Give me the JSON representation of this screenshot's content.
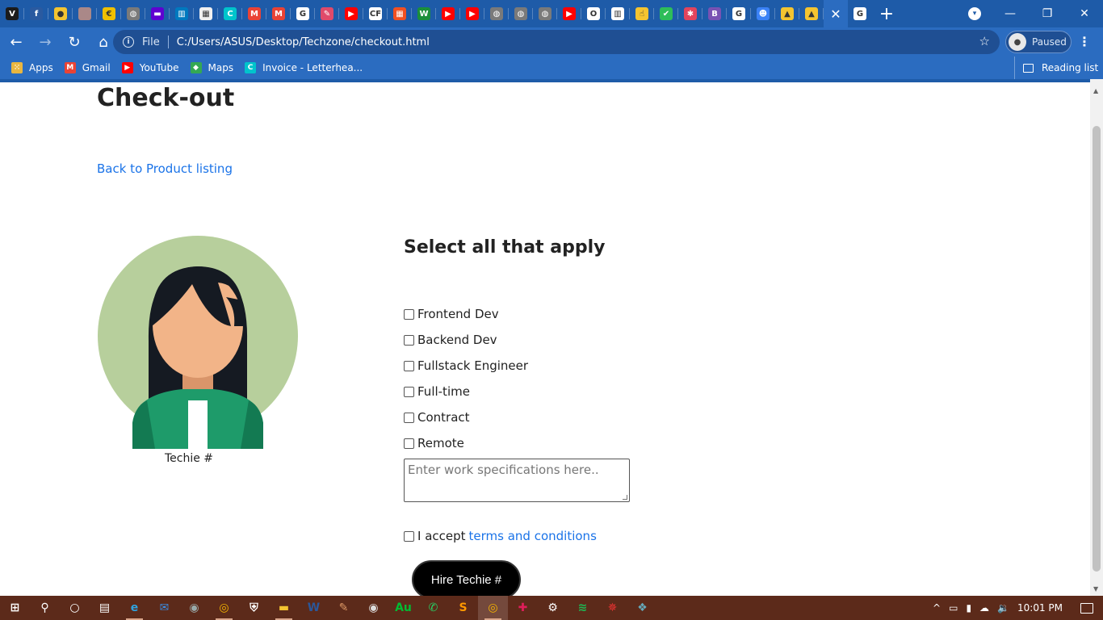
{
  "browser": {
    "tab_favicons": [
      {
        "name": "vuetify-icon",
        "color": "#1b1b1b",
        "glyph": "V"
      },
      {
        "name": "feather-icon",
        "color": "#2a5aa0",
        "glyph": "f"
      },
      {
        "name": "circle-yellow-icon",
        "color": "#f4c430",
        "glyph": "●"
      },
      {
        "name": "profile-photo-icon",
        "color": "#a88",
        "glyph": ""
      },
      {
        "name": "coinbase-icon",
        "color": "#f0c000",
        "glyph": "€"
      },
      {
        "name": "globe-icon",
        "color": "#7a7a7a",
        "glyph": "◍"
      },
      {
        "name": "yahoo-icon",
        "color": "#5f01d1",
        "glyph": "▬"
      },
      {
        "name": "trello-icon",
        "color": "#0079bf",
        "glyph": "▥"
      },
      {
        "name": "jsfiddle-icon",
        "color": "#f0f0f0",
        "glyph": "▦"
      },
      {
        "name": "canva-icon",
        "color": "#00c4cc",
        "glyph": "C"
      },
      {
        "name": "gmail-icon",
        "color": "#ea4335",
        "glyph": "M"
      },
      {
        "name": "gmail-icon-2",
        "color": "#ea4335",
        "glyph": "M"
      },
      {
        "name": "google-icon",
        "color": "#ffffff",
        "glyph": "G"
      },
      {
        "name": "quill-icon",
        "color": "#e04a6a",
        "glyph": "✎"
      },
      {
        "name": "youtube-icon",
        "color": "#ff0000",
        "glyph": "▶"
      },
      {
        "name": "codeforces-icon",
        "color": "#ffffff",
        "glyph": "CF"
      },
      {
        "name": "microsoft-icon",
        "color": "#f25022",
        "glyph": "▦"
      },
      {
        "name": "w-icon",
        "color": "#1a8f3a",
        "glyph": "W"
      },
      {
        "name": "youtube-icon-2",
        "color": "#ff0000",
        "glyph": "▶"
      },
      {
        "name": "youtube-icon-3",
        "color": "#ff0000",
        "glyph": "▶"
      },
      {
        "name": "globe-icon-2",
        "color": "#7a7a7a",
        "glyph": "◍"
      },
      {
        "name": "globe-icon-3",
        "color": "#7a7a7a",
        "glyph": "◍"
      },
      {
        "name": "globe-icon-4",
        "color": "#7a7a7a",
        "glyph": "◍"
      },
      {
        "name": "youtube-icon-4",
        "color": "#ff0000",
        "glyph": "▶"
      },
      {
        "name": "outlook-icon",
        "color": "#ffffff",
        "glyph": "O"
      },
      {
        "name": "trello-icon-2",
        "color": "#ffffff",
        "glyph": "▥"
      },
      {
        "name": "finger-icon",
        "color": "#f4c430",
        "glyph": "☝"
      },
      {
        "name": "check-icon",
        "color": "#2ebd59",
        "glyph": "✔"
      },
      {
        "name": "asterisk-icon",
        "color": "#e2445c",
        "glyph": "✱"
      },
      {
        "name": "bootstrap-icon",
        "color": "#7952b3",
        "glyph": "B"
      },
      {
        "name": "google-icon-2",
        "color": "#ffffff",
        "glyph": "G"
      },
      {
        "name": "puzzle-icon",
        "color": "#3b82f6",
        "glyph": "☻"
      },
      {
        "name": "image-icon",
        "color": "#f4c430",
        "glyph": "▲"
      },
      {
        "name": "image-icon-2",
        "color": "#f4c430",
        "glyph": "▲"
      }
    ],
    "active_tab_close": "✕",
    "after_active_favicon": {
      "name": "google-icon-3",
      "color": "#ffffff",
      "glyph": "G"
    },
    "new_tab": "+",
    "window_controls": {
      "minimize": "—",
      "restore": "❐",
      "close": "✕"
    },
    "tab_search": "▾",
    "nav": {
      "back": "←",
      "forward": "→",
      "reload": "↻",
      "home": "⌂"
    },
    "omnibox": {
      "info": "i",
      "scheme_label": "File",
      "url": "C:/Users/ASUS/Desktop/Techzone/checkout.html",
      "star": "☆"
    },
    "profile": {
      "label": "Paused"
    },
    "menu": "⋮",
    "bookmarks": [
      {
        "label": "Apps",
        "icon": "apps-grid-icon",
        "color": "#e9b640",
        "glyph": "⁙"
      },
      {
        "label": "Gmail",
        "icon": "gmail-icon",
        "color": "#ea4335",
        "glyph": "M"
      },
      {
        "label": "YouTube",
        "icon": "youtube-icon",
        "color": "#ff0000",
        "glyph": "▶"
      },
      {
        "label": "Maps",
        "icon": "maps-icon",
        "color": "#34a853",
        "glyph": "◆"
      },
      {
        "label": "Invoice - Letterhea...",
        "icon": "canva-icon",
        "color": "#00c4cc",
        "glyph": "C"
      }
    ],
    "reading_list": "Reading list"
  },
  "page": {
    "title": "Check-out",
    "back_link": "Back to Product listing",
    "avatar_caption": "Techie #",
    "form_heading": "Select all that apply",
    "options": [
      "Frontend Dev",
      "Backend Dev",
      "Fullstack Engineer",
      "Full-time",
      "Contract",
      "Remote"
    ],
    "textarea_placeholder": "Enter work specifications here..",
    "terms_prefix": "I accept",
    "terms_link": "terms and conditions",
    "submit": "Hire Techie #"
  },
  "taskbar": {
    "apps": [
      {
        "name": "start-icon",
        "color": "#ffffff",
        "glyph": "⊞"
      },
      {
        "name": "search-icon",
        "color": "#ffffff",
        "glyph": "⚲"
      },
      {
        "name": "cortana-icon",
        "color": "#ffffff",
        "glyph": "○"
      },
      {
        "name": "task-view-icon",
        "color": "#ffffff",
        "glyph": "▤"
      },
      {
        "name": "edge-icon",
        "color": "#2fa3e0",
        "glyph": "e"
      },
      {
        "name": "mail-icon",
        "color": "#3a8ee6",
        "glyph": "✉"
      },
      {
        "name": "camera-icon",
        "color": "#9aa",
        "glyph": "◉"
      },
      {
        "name": "chrome-icon",
        "color": "#f4b400",
        "glyph": "◎"
      },
      {
        "name": "security-icon",
        "color": "#ffffff",
        "glyph": "⛨"
      },
      {
        "name": "file-explorer-icon",
        "color": "#f4c430",
        "glyph": "▬"
      },
      {
        "name": "word-icon",
        "color": "#2b579a",
        "glyph": "W"
      },
      {
        "name": "paint-icon",
        "color": "#d96",
        "glyph": "✎"
      },
      {
        "name": "media-icon",
        "color": "#ddd",
        "glyph": "◉"
      },
      {
        "name": "audition-icon",
        "color": "#0b3",
        "glyph": "Au"
      },
      {
        "name": "whatsapp-icon",
        "color": "#25d366",
        "glyph": "✆"
      },
      {
        "name": "sublime-icon",
        "color": "#ff9800",
        "glyph": "S"
      },
      {
        "name": "chrome-icon-2",
        "color": "#f4b400",
        "glyph": "◎"
      },
      {
        "name": "slack-icon",
        "color": "#e01e5a",
        "glyph": "✚"
      },
      {
        "name": "settings-icon",
        "color": "#ffffff",
        "glyph": "⚙"
      },
      {
        "name": "spotify-icon",
        "color": "#1db954",
        "glyph": "≋"
      },
      {
        "name": "compass-icon",
        "color": "#e33",
        "glyph": "✵"
      },
      {
        "name": "palette-icon",
        "color": "#6ab",
        "glyph": "❖"
      }
    ],
    "open_indices": [
      4,
      7,
      9,
      16
    ],
    "active_index": 16,
    "tray": {
      "chevron": "^",
      "time": "10:01 PM",
      "volume": "🔉",
      "cloud": "☁"
    }
  }
}
